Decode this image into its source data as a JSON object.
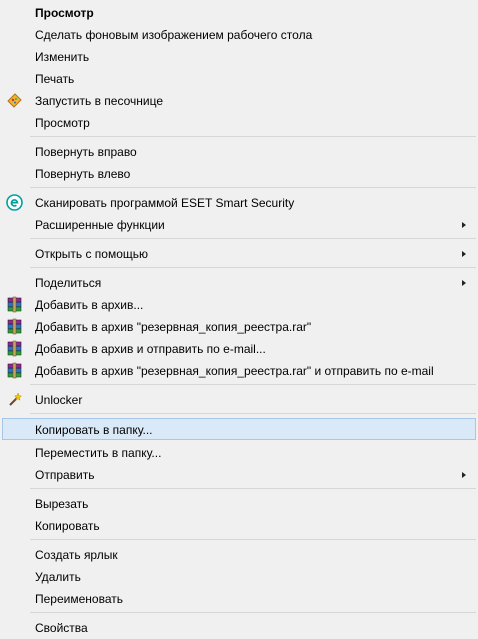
{
  "menu": {
    "items": [
      {
        "label": "Просмотр"
      },
      {
        "label": "Сделать фоновым изображением рабочего стола"
      },
      {
        "label": "Изменить"
      },
      {
        "label": "Печать"
      },
      {
        "label": "Запустить в песочнице",
        "icon": "sandbox-icon"
      },
      {
        "label": "Просмотр"
      },
      {
        "label": "Повернуть вправо"
      },
      {
        "label": "Повернуть влево"
      },
      {
        "label": "Сканировать программой ESET Smart Security",
        "icon": "eset-icon"
      },
      {
        "label": "Расширенные функции"
      },
      {
        "label": "Открыть с помощью"
      },
      {
        "label": "Поделиться"
      },
      {
        "label": "Добавить в архив...",
        "icon": "winrar-icon"
      },
      {
        "label": "Добавить в архив \"резервная_копия_реестра.rar\"",
        "icon": "winrar-icon"
      },
      {
        "label": "Добавить в архив и отправить по e-mail...",
        "icon": "winrar-icon"
      },
      {
        "label": "Добавить в архив \"резервная_копия_реестра.rar\" и отправить по e-mail",
        "icon": "winrar-icon"
      },
      {
        "label": "Unlocker",
        "icon": "unlocker-wand-icon"
      },
      {
        "label": "Копировать в папку..."
      },
      {
        "label": "Переместить в папку..."
      },
      {
        "label": "Отправить"
      },
      {
        "label": "Вырезать"
      },
      {
        "label": "Копировать"
      },
      {
        "label": "Создать ярлык"
      },
      {
        "label": "Удалить"
      },
      {
        "label": "Переименовать"
      },
      {
        "label": "Свойства"
      }
    ]
  },
  "colors": {
    "background": "#f0f0f0",
    "highlight": "#dae9f8",
    "highlight_border": "#a6c7ea",
    "separator": "#d7d7d7",
    "eset_teal": "#00a0a0"
  }
}
